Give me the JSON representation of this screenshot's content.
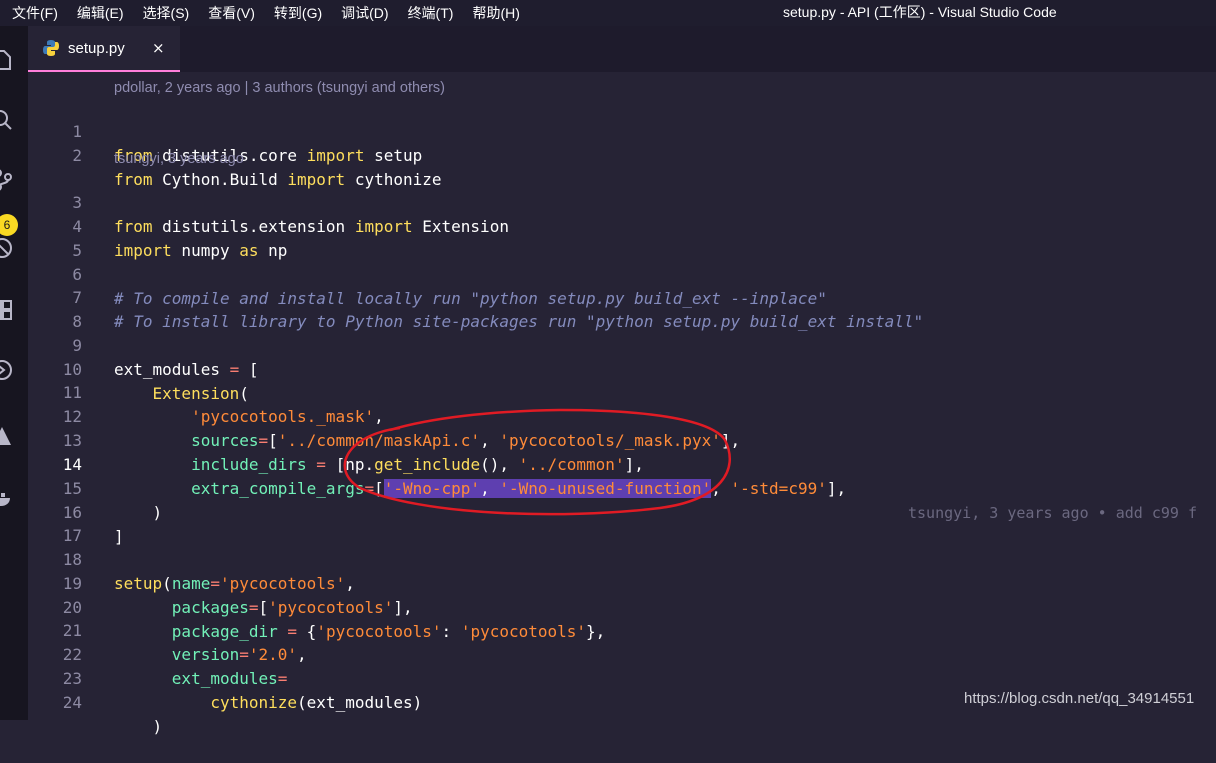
{
  "menu": [
    "文件(F)",
    "编辑(E)",
    "选择(S)",
    "查看(V)",
    "转到(G)",
    "调试(D)",
    "终端(T)",
    "帮助(H)"
  ],
  "window_title": "setup.py - API (工作区) - Visual Studio Code",
  "activity": {
    "scm_badge": "6"
  },
  "tab": {
    "label": "setup.py",
    "close": "×"
  },
  "codelens": {
    "first": "pdollar, 2 years ago | 3 authors (tsungyi and others)",
    "second": "tsungyi, 3 years ago"
  },
  "lines": [
    {
      "n": "1",
      "text": "from distutils.core import setup"
    },
    {
      "n": "2",
      "text": "from Cython.Build import cythonize"
    },
    {
      "n": "3",
      "text": "from distutils.extension import Extension"
    },
    {
      "n": "4",
      "text": "import numpy as np"
    },
    {
      "n": "5",
      "text": ""
    },
    {
      "n": "6",
      "text": "# To compile and install locally run \"python setup.py build_ext --inplace\""
    },
    {
      "n": "7",
      "text": "# To install library to Python site-packages run \"python setup.py build_ext install\""
    },
    {
      "n": "8",
      "text": ""
    },
    {
      "n": "9",
      "text": "ext_modules = ["
    },
    {
      "n": "10",
      "text": "    Extension("
    },
    {
      "n": "11",
      "text": "        'pycocotools._mask',"
    },
    {
      "n": "12",
      "text": "        sources=['../common/maskApi.c', 'pycocotools/_mask.pyx'],"
    },
    {
      "n": "13",
      "text": "        include_dirs = [np.get_include(), '../common'],"
    },
    {
      "n": "14",
      "text": "        extra_compile_args=['-Wno-cpp', '-Wno-unused-function', '-std=c99'],"
    },
    {
      "n": "15",
      "text": "    )"
    },
    {
      "n": "16",
      "text": "]"
    },
    {
      "n": "17",
      "text": ""
    },
    {
      "n": "18",
      "text": "setup(name='pycocotools',"
    },
    {
      "n": "19",
      "text": "      packages=['pycocotools'],"
    },
    {
      "n": "20",
      "text": "      package_dir = {'pycocotools': 'pycocotools'},"
    },
    {
      "n": "21",
      "text": "      version='2.0',"
    },
    {
      "n": "22",
      "text": "      ext_modules="
    },
    {
      "n": "23",
      "text": "          cythonize(ext_modules)"
    },
    {
      "n": "24",
      "text": "    )"
    }
  ],
  "blame_inline": "tsungyi, 3 years ago • add c99 f",
  "watermark": "https://blog.csdn.net/qq_34914551",
  "colors": {
    "accent": "#ff7edb",
    "selection": "#5e3fb0",
    "annotation": "#e01b24"
  }
}
